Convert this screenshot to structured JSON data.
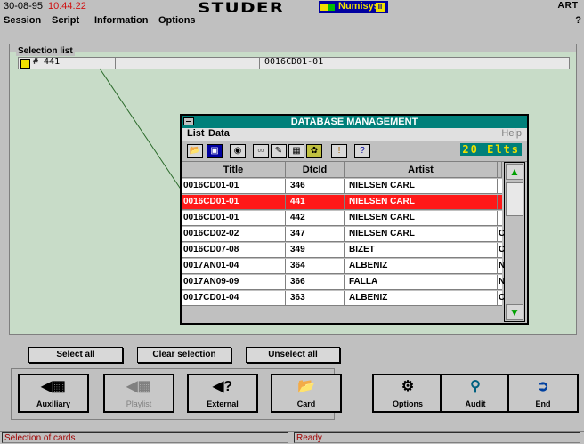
{
  "titlebar": {
    "date": "30-08-95",
    "time": "10:44:22",
    "brand": "STUDER",
    "product": "Numisys",
    "product_version": "II",
    "corner": "ART"
  },
  "menu": {
    "items": [
      "Session",
      "Script",
      "Information",
      "Options"
    ],
    "help": "?"
  },
  "selection_list": {
    "label": "Selection list",
    "row": {
      "number": "# 441",
      "code": "0016CD01-01"
    }
  },
  "database_window": {
    "title": "DATABASE MANAGEMENT",
    "menu": [
      "List",
      "Data"
    ],
    "help": "Help",
    "count": "20 Elts",
    "columns": [
      "Title",
      "DtcId",
      "Artist"
    ],
    "rows": [
      {
        "title": "0016CD01-01",
        "dtcid": "346",
        "artist": "NIELSEN CARL",
        "extra": "",
        "selected": false
      },
      {
        "title": "0016CD01-01",
        "dtcid": "441",
        "artist": "NIELSEN CARL",
        "extra": "",
        "selected": true
      },
      {
        "title": "0016CD01-01",
        "dtcid": "442",
        "artist": "NIELSEN CARL",
        "extra": "",
        "selected": false
      },
      {
        "title": "0016CD02-02",
        "dtcid": "347",
        "artist": "NIELSEN CARL",
        "extra": "C",
        "selected": false
      },
      {
        "title": "0016CD07-08",
        "dtcid": "349",
        "artist": "BIZET",
        "extra": "C",
        "selected": false
      },
      {
        "title": "0017AN01-04",
        "dtcid": "364",
        "artist": "ALBENIZ",
        "extra": "N",
        "selected": false
      },
      {
        "title": "0017AN09-09",
        "dtcid": "366",
        "artist": "FALLA",
        "extra": "N",
        "selected": false
      },
      {
        "title": "0017CD01-04",
        "dtcid": "363",
        "artist": "ALBENIZ",
        "extra": "C",
        "selected": false
      }
    ]
  },
  "selection_buttons": {
    "select_all": "Select all",
    "clear_selection": "Clear selection",
    "unselect_all": "Unselect all"
  },
  "big_buttons": {
    "auxiliary": "Auxiliary",
    "playlist": "Playlist",
    "external": "External",
    "card": "Card",
    "options": "Options",
    "audit": "Audit",
    "end": "End"
  },
  "status": {
    "left": "Selection of cards",
    "right": "Ready"
  },
  "colors": {
    "selection_area": "#c8dcc8",
    "db_titlebar": "#00807a",
    "selected_row": "#ff1818",
    "time": "#d01010"
  }
}
